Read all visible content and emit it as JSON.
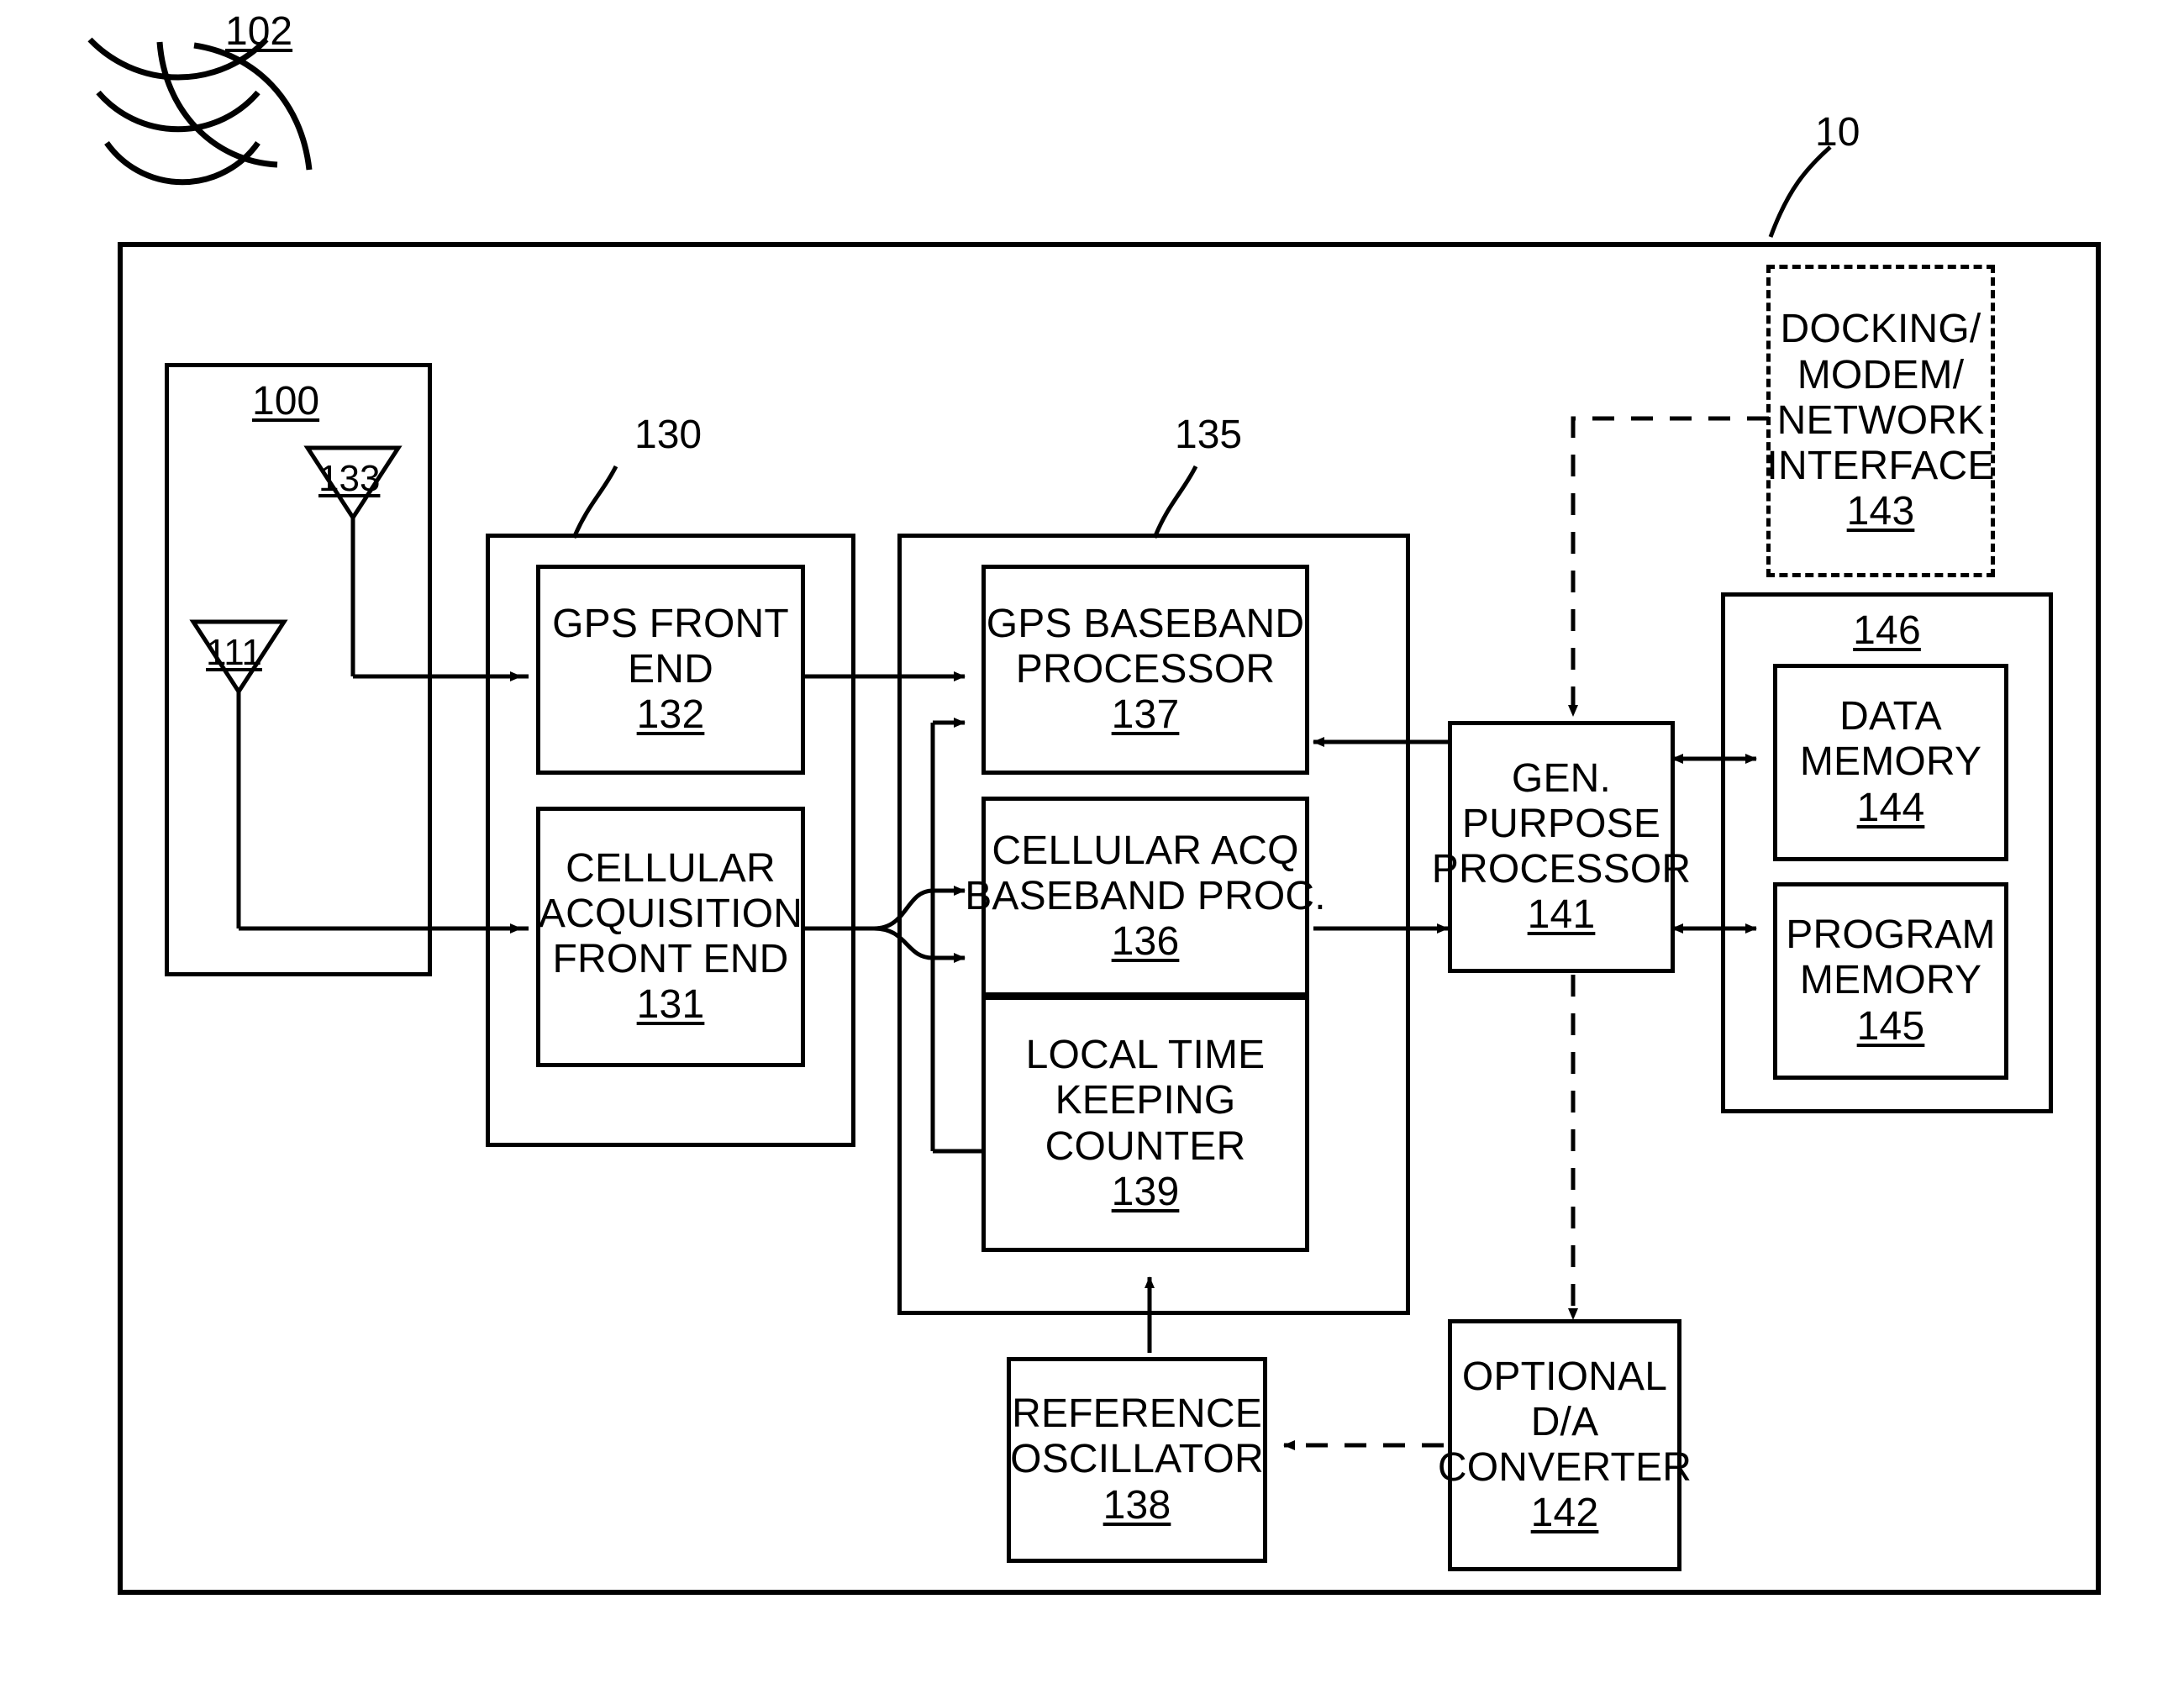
{
  "figure": {
    "type": "patent-block-diagram",
    "title_label": "10",
    "signal_waves_label": "102",
    "outer_device_label": "10"
  },
  "labels": {
    "signal_102": "102",
    "device_10": "10",
    "antenna_group_100": "100",
    "antenna_133": "133",
    "antenna_111": "111",
    "front_end_group_130": "130",
    "baseband_group_135": "135"
  },
  "blocks": {
    "gps_front_end": {
      "lines": [
        "GPS FRONT",
        "END"
      ],
      "ref": "132"
    },
    "cellular_front_end": {
      "lines": [
        "CELLULAR",
        "ACQUISITION",
        "FRONT END"
      ],
      "ref": "131"
    },
    "gps_baseband": {
      "lines": [
        "GPS BASEBAND",
        "PROCESSOR"
      ],
      "ref": "137"
    },
    "cellular_baseband": {
      "lines": [
        "CELLULAR ACQ",
        "BASEBAND PROC."
      ],
      "ref": "136"
    },
    "local_time_counter": {
      "lines": [
        "LOCAL TIME",
        "KEEPING",
        "COUNTER"
      ],
      "ref": "139"
    },
    "reference_oscillator": {
      "lines": [
        "REFERENCE",
        "OSCILLATOR"
      ],
      "ref": "138"
    },
    "gen_purpose_processor": {
      "lines": [
        "GEN.",
        "PURPOSE",
        "PROCESSOR"
      ],
      "ref": "141"
    },
    "optional_da_converter": {
      "lines": [
        "OPTIONAL",
        "D/A",
        "CONVERTER"
      ],
      "ref": "142"
    },
    "docking_modem_network": {
      "lines": [
        "DOCKING/",
        "MODEM/",
        "NETWORK",
        "INTERFACE"
      ],
      "ref": "143"
    },
    "memory_group": {
      "ref": "146"
    },
    "data_memory": {
      "lines": [
        "DATA",
        "MEMORY"
      ],
      "ref": "144"
    },
    "program_memory": {
      "lines": [
        "PROGRAM",
        "MEMORY"
      ],
      "ref": "145"
    }
  },
  "colors": {
    "ink": "#000000",
    "paper": "#ffffff"
  }
}
